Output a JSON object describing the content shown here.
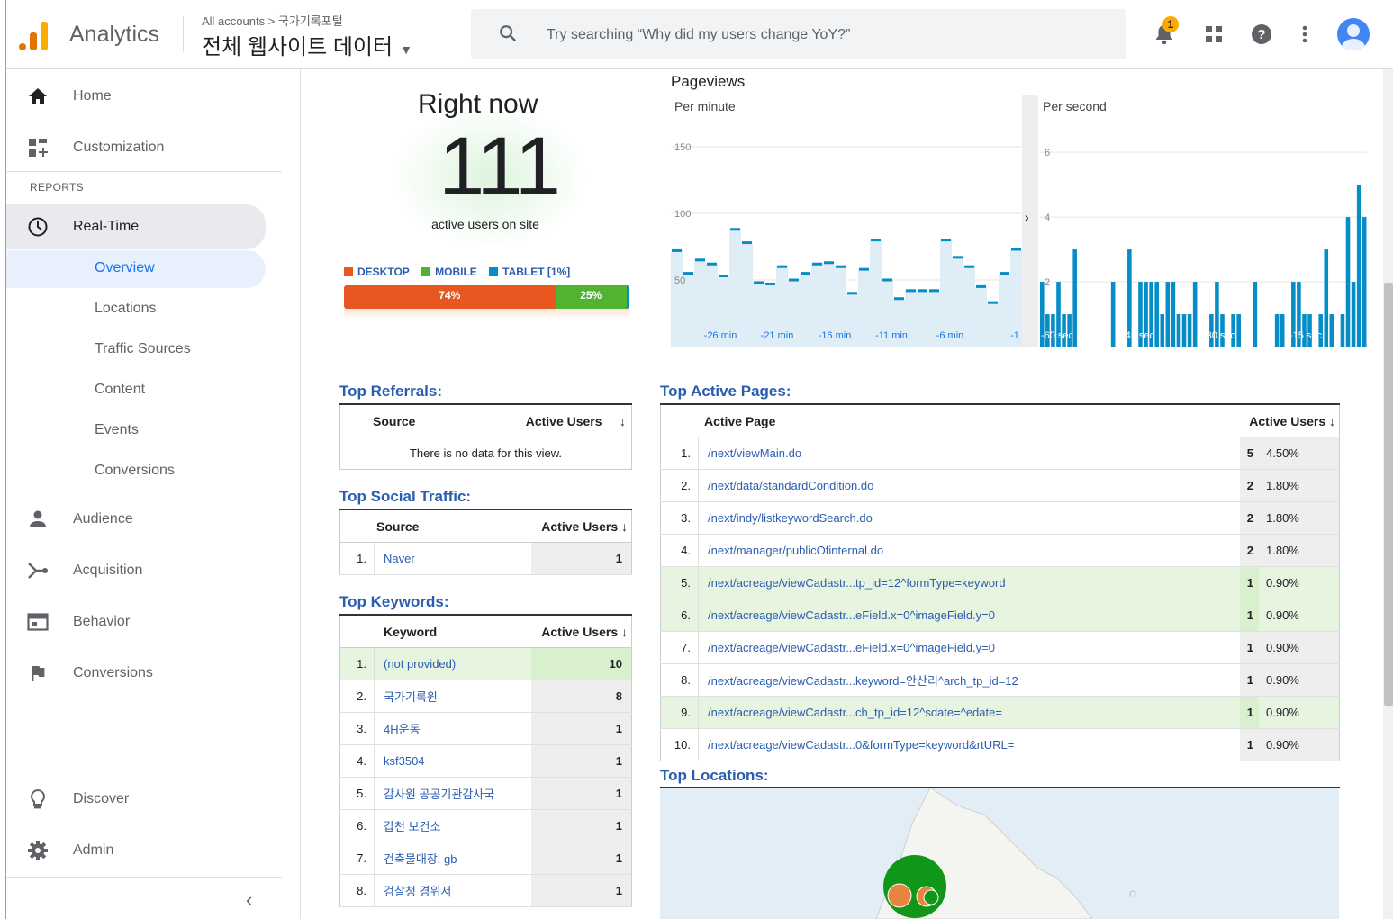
{
  "header": {
    "app_name": "Analytics",
    "breadcrumb": "All accounts > 국가기록포털",
    "view_name": "전체 웹사이트 데이터",
    "search_placeholder": "Try searching “Why did my users change YoY?”",
    "notification_count": "1",
    "icons": [
      "analytics-logo-icon",
      "search-icon",
      "bell-icon",
      "apps-grid-icon",
      "help-icon",
      "more-vert-icon",
      "avatar-icon"
    ]
  },
  "sidebar": {
    "home": "Home",
    "customization": "Customization",
    "reports_label": "REPORTS",
    "realtime": "Real-Time",
    "realtime_sub": [
      "Overview",
      "Locations",
      "Traffic Sources",
      "Content",
      "Events",
      "Conversions"
    ],
    "audience": "Audience",
    "acquisition": "Acquisition",
    "behavior": "Behavior",
    "conversions": "Conversions",
    "discover": "Discover",
    "admin": "Admin",
    "collapse": "‹"
  },
  "right_now": {
    "title": "Right now",
    "count": "111",
    "subtitle": "active users on site",
    "legend": [
      {
        "label": "DESKTOP",
        "color": "#e8571f"
      },
      {
        "label": "MOBILE",
        "color": "#50b432"
      },
      {
        "label": "TABLET [1%]",
        "color": "#058dc7"
      }
    ],
    "bar": [
      {
        "label": "74%",
        "value": 74,
        "color": "#e8571f"
      },
      {
        "label": "25%",
        "value": 25,
        "color": "#50b432"
      },
      {
        "label": "",
        "value": 1,
        "color": "#058dc7"
      }
    ]
  },
  "pageviews": {
    "title": "Pageviews",
    "per_minute_label": "Per minute",
    "per_second_label": "Per second",
    "min_y_ticks": [
      "150",
      "100",
      "50"
    ],
    "min_x_ticks": [
      "-26 min",
      "-21 min",
      "-16 min",
      "-11 min",
      "-6 min",
      "-1"
    ],
    "sec_y_ticks": [
      "6",
      "4",
      "2"
    ],
    "sec_x_ticks": [
      "-60 sec",
      "-45 sec",
      "-30 sec",
      "-15 sec"
    ]
  },
  "chart_data": [
    {
      "type": "area",
      "title": "Per minute",
      "ylim": [
        0,
        175
      ],
      "x": [
        -30,
        -29,
        -28,
        -27,
        -26,
        -25,
        -24,
        -23,
        -22,
        -21,
        -20,
        -19,
        -18,
        -17,
        -16,
        -15,
        -14,
        -13,
        -12,
        -11,
        -10,
        -9,
        -8,
        -7,
        -6,
        -5,
        -4,
        -3,
        -2,
        -1
      ],
      "values": [
        72,
        55,
        65,
        62,
        53,
        88,
        78,
        48,
        47,
        60,
        50,
        55,
        62,
        63,
        60,
        40,
        58,
        80,
        50,
        36,
        42,
        42,
        42,
        80,
        67,
        60,
        45,
        33,
        55,
        73
      ]
    },
    {
      "type": "bar",
      "title": "Per second",
      "ylim": [
        0,
        7.2
      ],
      "x": [
        -60,
        -59,
        -58,
        -57,
        -56,
        -55,
        -54,
        -53,
        -52,
        -51,
        -50,
        -49,
        -48,
        -47,
        -46,
        -45,
        -44,
        -43,
        -42,
        -41,
        -40,
        -39,
        -38,
        -37,
        -36,
        -35,
        -34,
        -33,
        -32,
        -31,
        -30,
        -29,
        -28,
        -27,
        -26,
        -25,
        -24,
        -23,
        -22,
        -21,
        -20,
        -19,
        -18,
        -17,
        -16,
        -15,
        -14,
        -13,
        -12,
        -11,
        -10,
        -9,
        -8,
        -7,
        -6,
        -5,
        -4,
        -3,
        -2,
        -1
      ],
      "values": [
        2,
        1,
        1,
        2,
        1,
        1,
        3,
        0,
        0,
        0,
        0,
        0,
        0,
        2,
        0,
        0,
        3,
        0,
        2,
        2,
        2,
        2,
        1,
        2,
        2,
        1,
        1,
        1,
        2,
        0,
        0,
        1,
        2,
        1,
        0,
        1,
        1,
        0,
        0,
        2,
        0,
        0,
        0,
        1,
        1,
        0,
        2,
        2,
        1,
        1,
        0,
        1,
        3,
        1,
        0,
        1,
        4,
        2,
        5,
        4
      ]
    }
  ],
  "top_referrals": {
    "title": "Top Referrals:",
    "col_source": "Source",
    "col_users": "Active Users",
    "empty": "There is no data for this view."
  },
  "top_social": {
    "title": "Top Social Traffic:",
    "col_source": "Source",
    "col_users": "Active Users",
    "rows": [
      {
        "idx": "1.",
        "source": "Naver",
        "users": "1"
      }
    ]
  },
  "top_keywords": {
    "title": "Top Keywords:",
    "col_keyword": "Keyword",
    "col_users": "Active Users",
    "rows": [
      {
        "idx": "1.",
        "keyword": "(not provided)",
        "users": "10"
      },
      {
        "idx": "2.",
        "keyword": "국가기록원",
        "users": "8"
      },
      {
        "idx": "3.",
        "keyword": "4H운동",
        "users": "1"
      },
      {
        "idx": "4.",
        "keyword": "ksf3504",
        "users": "1"
      },
      {
        "idx": "5.",
        "keyword": "감사원 공공기관감사국",
        "users": "1"
      },
      {
        "idx": "6.",
        "keyword": "갑천 보건소",
        "users": "1"
      },
      {
        "idx": "7.",
        "keyword": "건축물대장. gb",
        "users": "1"
      },
      {
        "idx": "8.",
        "keyword": "검찰청 경위서",
        "users": "1"
      }
    ]
  },
  "top_pages": {
    "title": "Top Active Pages:",
    "col_page": "Active Page",
    "col_users": "Active Users",
    "rows": [
      {
        "idx": "1.",
        "page": "/next/viewMain.do",
        "users": "5",
        "pct": "4.50%"
      },
      {
        "idx": "2.",
        "page": "/next/data/standardCondition.do",
        "users": "2",
        "pct": "1.80%"
      },
      {
        "idx": "3.",
        "page": "/next/indy/listkeywordSearch.do",
        "users": "2",
        "pct": "1.80%"
      },
      {
        "idx": "4.",
        "page": "/next/manager/publicOfinternal.do",
        "users": "2",
        "pct": "1.80%"
      },
      {
        "idx": "5.",
        "page": "/next/acreage/viewCadastr...tp_id=12^formType=keyword",
        "users": "1",
        "pct": "0.90%"
      },
      {
        "idx": "6.",
        "page": "/next/acreage/viewCadastr...eField.x=0^imageField.y=0",
        "users": "1",
        "pct": "0.90%"
      },
      {
        "idx": "7.",
        "page": "/next/acreage/viewCadastr...eField.x=0^imageField.y=0",
        "users": "1",
        "pct": "0.90%"
      },
      {
        "idx": "8.",
        "page": "/next/acreage/viewCadastr...keyword=안산리^arch_tp_id=12",
        "users": "1",
        "pct": "0.90%"
      },
      {
        "idx": "9.",
        "page": "/next/acreage/viewCadastr...ch_tp_id=12^sdate=^edate=",
        "users": "1",
        "pct": "0.90%"
      },
      {
        "idx": "10.",
        "page": "/next/acreage/viewCadastr...0&formType=keyword&rtURL=",
        "users": "1",
        "pct": "0.90%"
      }
    ]
  },
  "top_locations": {
    "title": "Top Locations:"
  }
}
